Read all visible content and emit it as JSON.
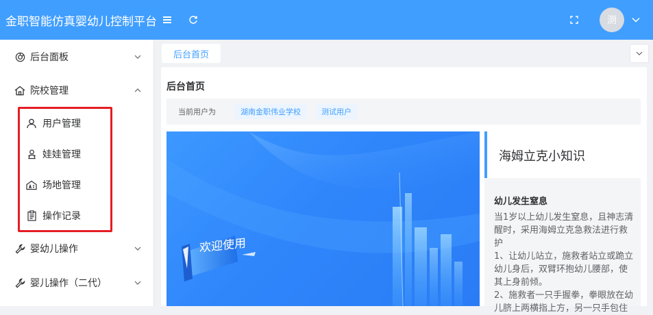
{
  "header": {
    "title": "金职智能仿真婴幼儿控制平台",
    "avatar_text": "测"
  },
  "sidebar": {
    "items": [
      {
        "label": "后台面板",
        "icon": "dashboard-icon",
        "expanded": false
      },
      {
        "label": "院校管理",
        "icon": "school-icon",
        "expanded": true,
        "children": [
          {
            "label": "用户管理",
            "icon": "user-icon"
          },
          {
            "label": "娃娃管理",
            "icon": "doll-icon"
          },
          {
            "label": "场地管理",
            "icon": "venue-icon"
          },
          {
            "label": "操作记录",
            "icon": "clipboard-icon"
          }
        ]
      },
      {
        "label": "婴幼儿操作",
        "icon": "wrench-icon",
        "expanded": false
      },
      {
        "label": "婴儿操作（二代）",
        "icon": "wrench-icon",
        "expanded": false
      }
    ]
  },
  "tabs": [
    {
      "label": "后台首页",
      "active": true
    }
  ],
  "main": {
    "page_title": "后台首页",
    "user_bar": {
      "label": "当前用户为",
      "school": "湖南金职伟业学校",
      "user": "测试用户"
    },
    "banner_text": "欢迎使用",
    "knowledge": {
      "title": "海姆立克小知识",
      "subtitle": "幼儿发生窒息",
      "paragraphs": [
        "当1岁以上幼儿发生窒息，且神志清醒时，采用海姆立克急救法进行救护",
        "1、让幼儿站立，施救者站立或跪立幼儿身后，双臂环抱幼儿腰部，使其上身前倾。",
        "2、施救者一只手握拳，拳眼放在幼儿脐上两横指上方，另一只手包住"
      ]
    }
  },
  "colors": {
    "primary": "#409eff",
    "highlight": "#e51c23"
  }
}
